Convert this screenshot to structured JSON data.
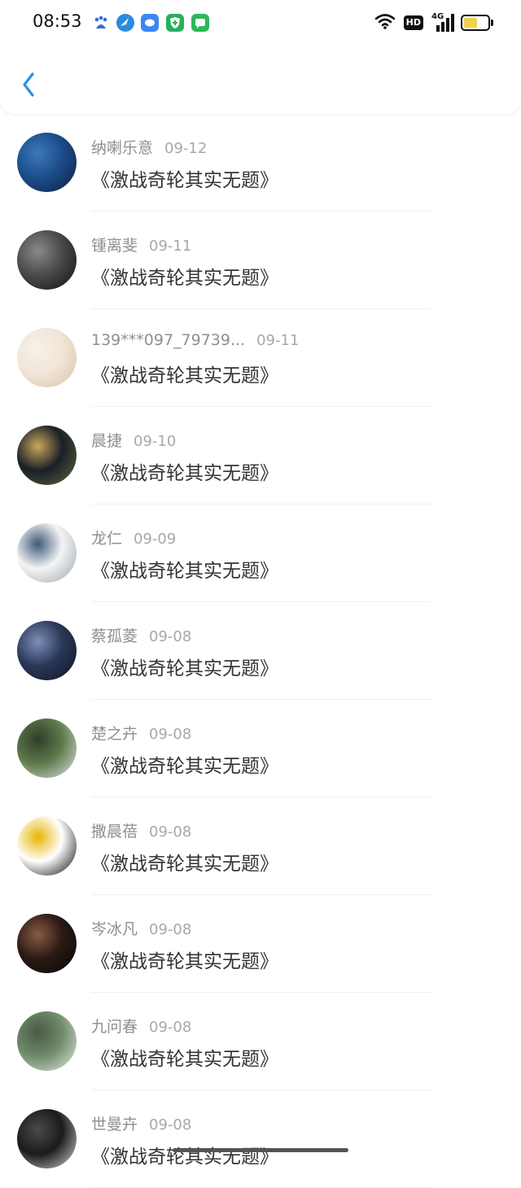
{
  "status_bar": {
    "time": "08:53",
    "hd_label": "HD",
    "network_label": "4G",
    "app_icons": [
      {
        "name": "baidu-icon",
        "color": "#2f6fe0"
      },
      {
        "name": "browser-icon",
        "color": "#2b8be0"
      },
      {
        "name": "chat-icon",
        "color": "#3d86f4"
      },
      {
        "name": "shield-icon",
        "color": "#27b05a"
      },
      {
        "name": "message-icon",
        "color": "#2cb75a"
      }
    ]
  },
  "header": {
    "back_icon": "chevron-left-icon",
    "accent": "#2f8ee6"
  },
  "items": [
    {
      "user": "纳喇乐意",
      "date": "09-12",
      "title": "《激战奇轮其实无题》",
      "avatar_colors": [
        "#1b4d8c",
        "#0f1e3a",
        "#3f78b8"
      ]
    },
    {
      "user": "锺离斐",
      "date": "09-11",
      "title": "《激战奇轮其实无题》",
      "avatar_colors": [
        "#4a4a4a",
        "#101010",
        "#8a8a8a"
      ]
    },
    {
      "user": "139***097_79739...",
      "date": "09-11",
      "title": "《激战奇轮其实无题》",
      "avatar_colors": [
        "#f1e6d8",
        "#d9c2a6",
        "#f7f1ea"
      ]
    },
    {
      "user": "晨捷",
      "date": "09-10",
      "title": "《激战奇轮其实无题》",
      "avatar_colors": [
        "#1a1f28",
        "#5d6a3a",
        "#c9a85a"
      ]
    },
    {
      "user": "龙仁",
      "date": "09-09",
      "title": "《激战奇轮其实无题》",
      "avatar_colors": [
        "#f4f4f4",
        "#9aa3ab",
        "#3e5a7a"
      ]
    },
    {
      "user": "蔡孤菱",
      "date": "09-08",
      "title": "《激战奇轮其实无题》",
      "avatar_colors": [
        "#2a3858",
        "#0e1220",
        "#7d8fb8"
      ]
    },
    {
      "user": "楚之卉",
      "date": "09-08",
      "title": "《激战奇轮其实无题》",
      "avatar_colors": [
        "#5e7a4a",
        "#dfe6ea",
        "#2f3d2a"
      ]
    },
    {
      "user": "撒晨蓓",
      "date": "09-08",
      "title": "《激战奇轮其实无题》",
      "avatar_colors": [
        "#ffffff",
        "#000000",
        "#e8b400"
      ]
    },
    {
      "user": "岑冰凡",
      "date": "09-08",
      "title": "《激战奇轮其实无题》",
      "avatar_colors": [
        "#2a1a14",
        "#050505",
        "#8a5a44"
      ]
    },
    {
      "user": "九问春",
      "date": "09-08",
      "title": "《激战奇轮其实无题》",
      "avatar_colors": [
        "#6f8a6a",
        "#e6ece4",
        "#4a5a46"
      ]
    },
    {
      "user": "世曼卉",
      "date": "09-08",
      "title": "《激战奇轮其实无题》",
      "avatar_colors": [
        "#1b1b1b",
        "#d8d8d8",
        "#4a4a4a"
      ]
    }
  ]
}
